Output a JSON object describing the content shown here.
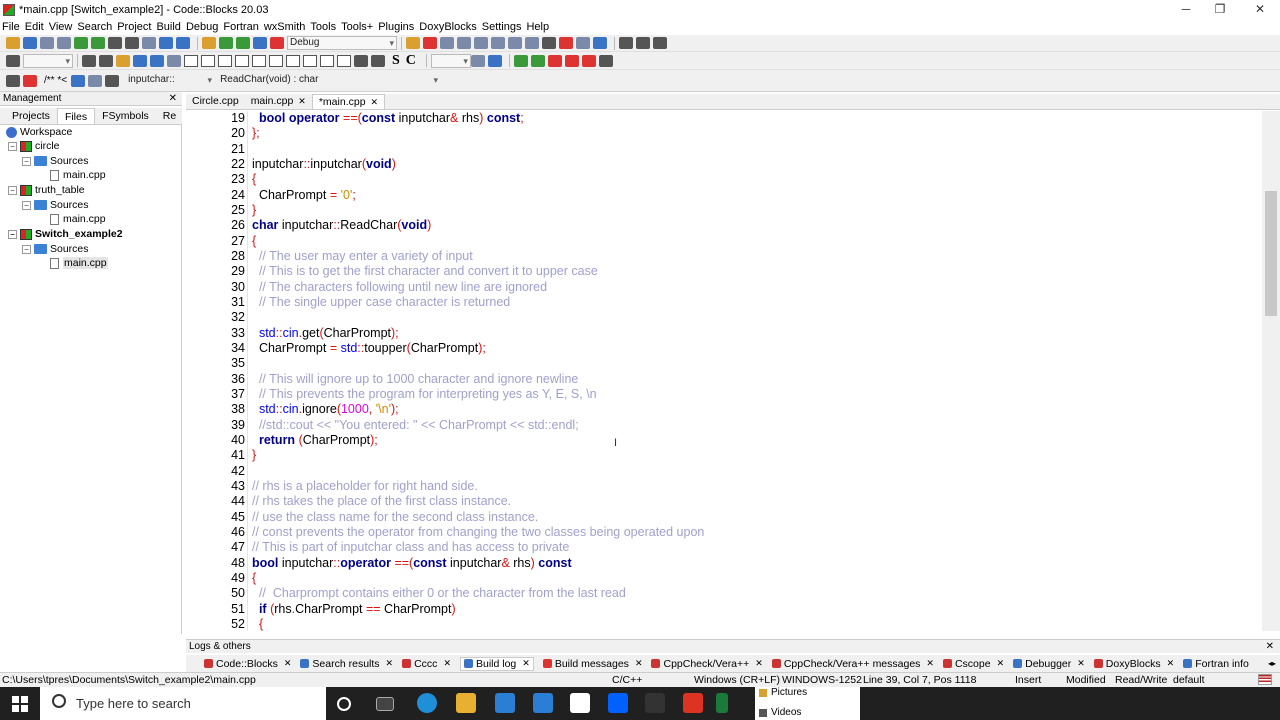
{
  "window": {
    "title": "*main.cpp [Switch_example2] - Code::Blocks 20.03"
  },
  "menu": [
    "File",
    "Edit",
    "View",
    "Search",
    "Project",
    "Build",
    "Debug",
    "Fortran",
    "wxSmith",
    "Tools",
    "Tools+",
    "Plugins",
    "DoxyBlocks",
    "Settings",
    "Help"
  ],
  "toolbar": {
    "build_target": "Debug",
    "scope": "inputchar::",
    "function": "ReadChar(void) : char",
    "doxy_label": "/** *<",
    "s_label": "S",
    "c_label": "C"
  },
  "management": {
    "title": "Management",
    "tabs": [
      "Projects",
      "Files",
      "FSymbols",
      "Re"
    ],
    "tree": {
      "workspace": "Workspace",
      "projects": [
        {
          "name": "circle",
          "folder": "Sources",
          "file": "main.cpp"
        },
        {
          "name": "truth_table",
          "folder": "Sources",
          "file": "main.cpp"
        },
        {
          "name": "Switch_example2",
          "folder": "Sources",
          "file": "main.cpp"
        }
      ]
    }
  },
  "editor": {
    "tabs": [
      {
        "label": "Circle.cpp",
        "active": false
      },
      {
        "label": "main.cpp",
        "active": false
      },
      {
        "label": "*main.cpp",
        "active": true
      }
    ],
    "line_numbers": [
      "19",
      "20",
      "21",
      "22",
      "23",
      "24",
      "25",
      "26",
      "27",
      "28",
      "29",
      "30",
      "31",
      "32",
      "33",
      "34",
      "35",
      "36",
      "37",
      "38",
      "39",
      "40",
      "41",
      "42",
      "43",
      "44",
      "45",
      "46",
      "47",
      "48",
      "49",
      "50",
      "51",
      "52"
    ]
  },
  "logs": {
    "title": "Logs & others",
    "tabs": [
      "Code::Blocks",
      "Search results",
      "Cccc",
      "Build log",
      "Build messages",
      "CppCheck/Vera++",
      "CppCheck/Vera++ messages",
      "Cscope",
      "Debugger",
      "DoxyBlocks",
      "Fortran info"
    ]
  },
  "status": {
    "path": "C:\\Users\\tpres\\Documents\\Switch_example2\\main.cpp",
    "language": "C/C++",
    "line_endings": "Windows (CR+LF)",
    "encoding": "WINDOWS-1252",
    "position": "Line 39, Col 7, Pos 1118",
    "insert": "Insert",
    "modified": "Modified",
    "rw": "Read/Write",
    "profile": "default"
  },
  "taskbar": {
    "search_placeholder": "Type here to search",
    "flyout": [
      "Pictures",
      "Videos"
    ]
  },
  "colors": {
    "keyword": "#00008b",
    "comment": "#a0a0cf",
    "string": "#d08a00",
    "brace": "#e01010",
    "std": "#0000ff",
    "number": "#e000e0"
  }
}
